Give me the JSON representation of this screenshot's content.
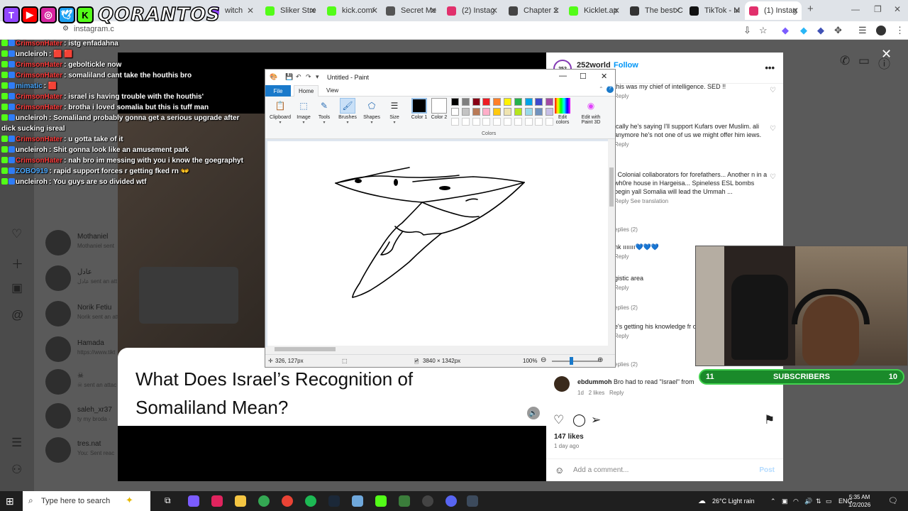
{
  "browser": {
    "tabs": [
      {
        "label": "witch",
        "color": "#9146ff"
      },
      {
        "label": "Sliker Stre",
        "color": "#53fc18"
      },
      {
        "label": "kick.com/",
        "color": "#53fc18"
      },
      {
        "label": "Secret Me",
        "color": "#555555"
      },
      {
        "label": "(2) Instag",
        "color": "#e1306c"
      },
      {
        "label": "Chapter 2",
        "color": "#444444"
      },
      {
        "label": "Kicklet.ap",
        "color": "#53fc18"
      },
      {
        "label": "The best C",
        "color": "#333333"
      },
      {
        "label": "TikTok - M",
        "color": "#111111"
      },
      {
        "label": "(1) Instag",
        "color": "#e1306c"
      }
    ],
    "url": "instagram.c"
  },
  "logo": {
    "brand": "QORANTOS"
  },
  "chat": [
    {
      "user": "CrimsonHater",
      "user_color": "#ff3b3b",
      "msg": "istg enfadahna"
    },
    {
      "user": "uncleiroh",
      "user_color": "#ffffff",
      "msg": "🟥 🟥"
    },
    {
      "user": "CrimsonHater",
      "user_color": "#ff3b3b",
      "msg": "geboltickle now"
    },
    {
      "user": "CrimsonHater",
      "user_color": "#ff3b3b",
      "msg": "somaliland cant take the houthis bro"
    },
    {
      "user": "mimatic",
      "user_color": "#4aa8ff",
      "msg": "🟥"
    },
    {
      "user": "CrimsonHater",
      "user_color": "#ff3b3b",
      "msg": "israel is having trouble with the houthis'"
    },
    {
      "user": "CrimsonHater",
      "user_color": "#ff3b3b",
      "msg": "brotha i loved somalia but this is tuff man"
    },
    {
      "user": "uncleiroh",
      "user_color": "#ffffff",
      "msg": "Somaliland probably gonna get a serious upgrade after dick sucking isreal"
    },
    {
      "user": "CrimsonHater",
      "user_color": "#ff3b3b",
      "msg": "u gotta take of it"
    },
    {
      "user": "uncleiroh",
      "user_color": "#ffffff",
      "msg": "Shit gonna look like an amusement park"
    },
    {
      "user": "CrimsonHater",
      "user_color": "#ff3b3b",
      "msg": "nah bro im messing with you i know the goegraphyt"
    },
    {
      "user": "ZOBO919",
      "user_color": "#4aa8ff",
      "msg": "rapid support forces r getting fked rn 👐"
    },
    {
      "user": "uncleiroh",
      "user_color": "#ffffff",
      "msg": "You guys are so divided wtf"
    }
  ],
  "dms": [
    {
      "name": "Mothaniel",
      "sub": "Mothaniel sent"
    },
    {
      "name": "عادل",
      "sub": "عادل sent an att"
    },
    {
      "name": "Norik Fetiu",
      "sub": "Norik sent an att"
    },
    {
      "name": "Hamada",
      "sub": "https://www.tikt"
    },
    {
      "name": "☠",
      "sub": "☠ sent an attac"
    },
    {
      "name": "saleh_xr37",
      "sub": "ty my broda ·"
    },
    {
      "name": "tres.nat",
      "sub": "You: Sent reac"
    }
  ],
  "paint": {
    "title": "Untitled - Paint",
    "menu": {
      "file": "File",
      "home": "Home",
      "view": "View"
    },
    "ribbon": {
      "clipboard": "Clipboard",
      "image": "Image",
      "tools": "Tools",
      "brushes": "Brushes",
      "shapes": "Shapes",
      "size": "Size",
      "color1": "Color 1",
      "color2": "Color 2",
      "edit_colors": "Edit colors",
      "edit_paint3d": "Edit with Paint 3D",
      "colors": "Colors"
    },
    "palette_row1": [
      "#000000",
      "#7f7f7f",
      "#880015",
      "#ed1c24",
      "#ff7f27",
      "#fff200",
      "#22b14c",
      "#00a2e8",
      "#3f48cc",
      "#a349a4"
    ],
    "palette_row2": [
      "#ffffff",
      "#c3c3c3",
      "#b97a57",
      "#ffaec9",
      "#ffc90e",
      "#efe4b0",
      "#b5e61d",
      "#99d9ea",
      "#7092be",
      "#c8bfe7"
    ],
    "status": {
      "cursor": "326, 127px",
      "size": "3840 × 1342px",
      "zoom": "100%"
    }
  },
  "video": {
    "caption": "What Does Israel’s Recognition of Somaliland Mean?"
  },
  "instagram": {
    "user": "252world",
    "avatar_text": "252",
    "follow": "Follow",
    "comments": [
      {
        "text": "this was my chief of intelligence. SED !!",
        "meta": "Reply"
      },
      {
        "text": "ically he's saying I'll support Kufars over Muslim. ali anymore he's not one of us we might offer him iews.",
        "meta": "Reply"
      },
      {
        "text": "l Colonial collaborators for forefathers... Another n in a wh0re house in Hargeisa... Spineless ESL bombs begin yall Somalia will lead the Ummah ...",
        "meta": "Reply   See translation"
      },
      {
        "text": "",
        "meta": "eplies (2)"
      },
      {
        "text": "nk ııııııı💙💙💙",
        "meta": "Reply"
      },
      {
        "text": "gistic area",
        "meta": "Reply"
      },
      {
        "text": "",
        "meta": "eplies (2)"
      },
      {
        "text": "e's getting his knowledge fr of intelligence baalayoo ku",
        "meta": "Reply"
      },
      {
        "text": "",
        "meta": "eplies (2)"
      }
    ],
    "last_comment": {
      "user": "ebdummoh",
      "text": "Bro had to read \"Israel\" from",
      "age": "1d",
      "likes": "2 likes",
      "reply": "Reply"
    },
    "likes": "147 likes",
    "ago": "1 day ago",
    "add_comment": "Add a comment...",
    "post": "Post"
  },
  "webcam": {
    "subs_left": "11",
    "subs_label": "SUBSCRIBERS",
    "subs_right": "10"
  },
  "taskbar": {
    "search": "Type here to search",
    "weather": "26°C  Light rain",
    "lang": "ENG",
    "time": "5:35 AM",
    "date": "1/2/2026"
  }
}
